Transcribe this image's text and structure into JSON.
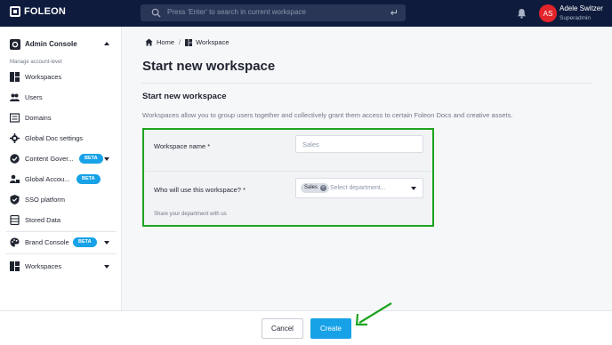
{
  "topbar": {
    "logo_text": "FOLEON",
    "search_placeholder": "Press 'Enter' to search in current workspace",
    "return_glyph": "↵",
    "icons": [
      "search-icon",
      "bell-icon",
      "return-icon"
    ],
    "user": {
      "initials": "AS",
      "name": "Adele Switzer",
      "role": "Superadmin",
      "avatar_color": "#e3242b"
    }
  },
  "sidebar": {
    "header": "Admin Console",
    "sub": "Manage account-level",
    "items": [
      {
        "label": "Workspaces",
        "icon": "workspaces-icon"
      },
      {
        "label": "Users",
        "icon": "users-icon"
      },
      {
        "label": "Domains",
        "icon": "domains-icon"
      },
      {
        "label": "Global Doc settings",
        "icon": "gear-icon"
      },
      {
        "label": "Content Gover...",
        "icon": "check-badge-icon",
        "badge": "BETA"
      },
      {
        "label": "Global Accou...",
        "icon": "user-lock-icon",
        "badge": "BETA"
      },
      {
        "label": "SSO platform",
        "icon": "shield-icon"
      },
      {
        "label": "Stored Data",
        "icon": "database-icon"
      }
    ],
    "brand_console": {
      "label": "Brand Console",
      "badge": "BETA",
      "icon": "palette-icon"
    },
    "workspaces_section": {
      "label": "Workspaces",
      "icon": "workspaces-icon"
    }
  },
  "breadcrumb": {
    "home": "Home",
    "separator": "/",
    "current": "Workspace"
  },
  "page": {
    "title": "Start new workspace",
    "subtitle": "Start new workspace",
    "description": "Workspaces allow you to group users together and collectively grant them access to certain Foleon Docs and creative assets."
  },
  "form": {
    "name_label": "Workspace name *",
    "name_placeholder": "Sales",
    "dept_label": "Who will use this workspace? *",
    "dept_chip": "Sales",
    "dept_placeholder": "Select department...",
    "hint": "Share your department with us"
  },
  "footer": {
    "cancel": "Cancel",
    "create": "Create"
  },
  "colors": {
    "topbar": "#0f1b3d",
    "accent": "#17a2e8",
    "highlight_border": "#1fa31f",
    "arrow": "#1fa31f"
  }
}
